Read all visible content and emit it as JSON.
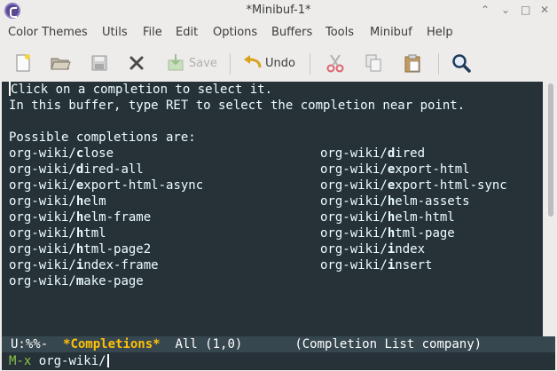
{
  "window": {
    "title": "*Minibuf-1*",
    "controls": {
      "up": "⌃",
      "minimize": "⌄",
      "maximize": "□",
      "close": "✕"
    }
  },
  "menubar": {
    "items": [
      "Color Themes",
      "Utils",
      "File",
      "Edit",
      "Options",
      "Buffers",
      "Tools",
      "Minibuf",
      "Help"
    ]
  },
  "toolbar": {
    "buttons": [
      {
        "icon": "new-file-icon"
      },
      {
        "icon": "open-folder-icon"
      },
      {
        "icon": "floppy-icon"
      },
      {
        "icon": "close-icon"
      },
      {
        "icon": "save-icon",
        "label": "Save"
      },
      {
        "icon": "undo-arrow-icon",
        "label": "Undo"
      },
      {
        "icon": "scissors-icon"
      },
      {
        "icon": "copy-icon"
      },
      {
        "icon": "paste-icon"
      },
      {
        "icon": "search-icon"
      }
    ]
  },
  "buffer": {
    "header_line1": "Click on a completion to select it.",
    "header_line2": "In this buffer, type RET to select the completion near point.",
    "possible_label": "Possible completions are:",
    "completion_prefix": "org-wiki/",
    "completions": [
      {
        "hl": "c",
        "rest": "lose"
      },
      {
        "hl": "d",
        "rest": "ired"
      },
      {
        "hl": "d",
        "rest": "ired-all"
      },
      {
        "hl": "e",
        "rest": "xport-html"
      },
      {
        "hl": "e",
        "rest": "xport-html-async"
      },
      {
        "hl": "e",
        "rest": "xport-html-sync"
      },
      {
        "hl": "h",
        "rest": "elm"
      },
      {
        "hl": "h",
        "rest": "elm-assets"
      },
      {
        "hl": "h",
        "rest": "elm-frame"
      },
      {
        "hl": "h",
        "rest": "elm-html"
      },
      {
        "hl": "h",
        "rest": "tml"
      },
      {
        "hl": "h",
        "rest": "tml-page"
      },
      {
        "hl": "h",
        "rest": "tml-page2"
      },
      {
        "hl": "i",
        "rest": "ndex"
      },
      {
        "hl": "i",
        "rest": "ndex-frame"
      },
      {
        "hl": "i",
        "rest": "nsert"
      },
      {
        "hl": "m",
        "rest": "ake-page"
      }
    ]
  },
  "modeline": {
    "status": "U:%%-",
    "buffer_name": "*Completions*",
    "position": "All (1,0)",
    "modes": "(Completion List company)"
  },
  "minibuffer": {
    "prompt": "M-x",
    "input": "org-wiki/"
  },
  "colors": {
    "buffer_bg": "#263238",
    "modeline_bg": "#37474f",
    "modeline_buffer_name": "#ffc107",
    "prompt": "#8bc34a"
  }
}
